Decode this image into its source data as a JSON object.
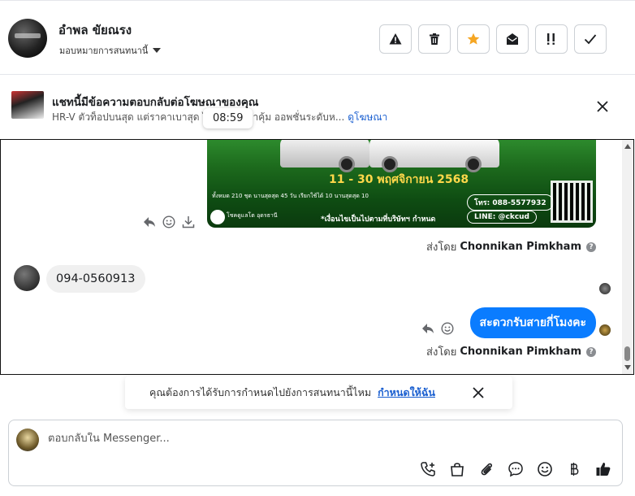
{
  "header": {
    "contact_name": "อำพล ขัยณรง",
    "assign_label": "มอบหมายการสนทนานี้",
    "actions": [
      {
        "name": "report-button",
        "icon": "warning-icon"
      },
      {
        "name": "delete-button",
        "icon": "trash-icon"
      },
      {
        "name": "star-button",
        "icon": "star-icon"
      },
      {
        "name": "mark-unread-button",
        "icon": "envelope-open-icon"
      },
      {
        "name": "follow-up-button",
        "icon": "flag-exclaim-icon"
      },
      {
        "name": "done-button",
        "icon": "check-icon"
      }
    ]
  },
  "ad": {
    "title": "แชทนี้มีข้อความตอบกลับต่อโฆษณาของคุณ",
    "subtitle": "HR-V ตัวท็อปบนสุด แต่ราคาเบาสุด ได้... ...คำว่าคุ้ม ออพชั่นระดับห...",
    "link": "ดูโฆษณา",
    "tooltip_time": "08:59"
  },
  "banner": {
    "date_text": "11 - 30 พฤศจิกายน 2568",
    "tel": "โทร: 088-5577932",
    "line": "LINE: @ckcud",
    "condition": "*เงื่อนไขเป็นไปตามที่บริษัทฯ กำหนด",
    "shop": "โชคดูแลโต อุดรธานี",
    "stats": "ทั้งหมด 210 ชุด   นานสุดสุด 45 วัน   เรียกใช้ได้ 10   นานสุดสุด 10"
  },
  "messages": {
    "sent_by_label": "ส่งโดย",
    "sender_1": "Chonnikan Pimkham",
    "incoming_text": "094-0560913",
    "outgoing_text": "สะดวกรับสายกี่โมงคะ",
    "sender_2": "Chonnikan Pimkham",
    "info": "?"
  },
  "reminder": {
    "text": "คุณต้องการได้รับการกำหนดไปยังการสนทนานี้ไหม",
    "link": "กำหนดให้ฉัน"
  },
  "composer": {
    "placeholder": "ตอบกลับใน Messenger...",
    "tools": [
      "call-add-icon",
      "shopping-bag-icon",
      "paperclip-icon",
      "chat-bubble-icon",
      "emoji-icon",
      "baht-icon",
      "thumbs-up-icon"
    ]
  },
  "colors": {
    "accent": "#0a7cff",
    "star": "#f5a623",
    "link": "#1a5fd0"
  }
}
